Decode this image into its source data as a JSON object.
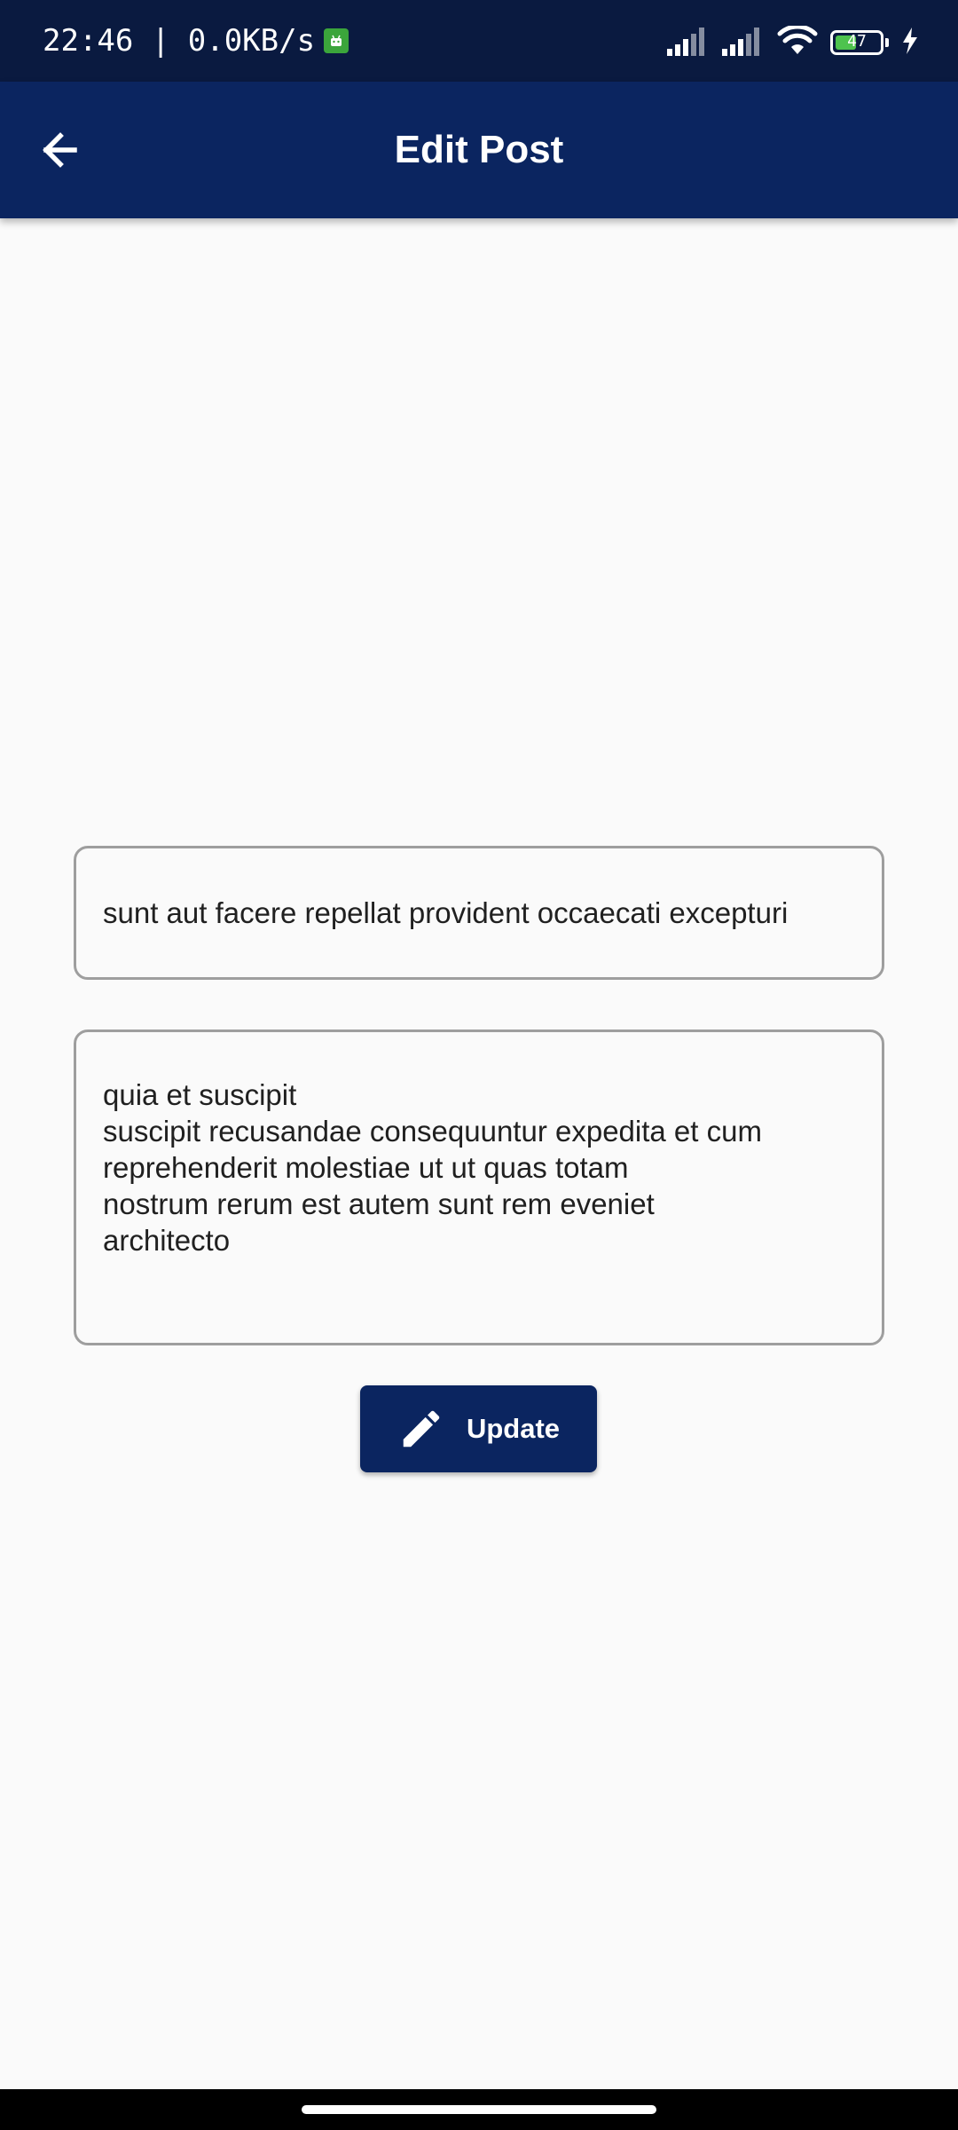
{
  "status_bar": {
    "time_speed": "22:46 | 0.0KB/s",
    "battery_level": "47",
    "battery_fraction": 0.47,
    "icons": [
      "signal-icon",
      "signal-icon",
      "wifi-icon",
      "battery-icon",
      "charging-icon"
    ]
  },
  "app_bar": {
    "title": "Edit Post",
    "back_icon": "arrow-left-icon"
  },
  "form": {
    "title_value": "sunt aut facere repellat provident occaecati excepturi",
    "body_lines": [
      "quia et suscipit",
      "suscipit recusandae consequuntur expedita et cum",
      "reprehenderit molestiae ut ut quas totam",
      "nostrum rerum est autem sunt rem eveniet",
      "architecto"
    ],
    "update_label": "Update",
    "update_icon": "pencil-icon"
  },
  "colors": {
    "status_bar": "#0a1a40",
    "app_bar": "#0b2560",
    "button": "#0b2560",
    "background": "#fafafa",
    "field_border": "#9e9e9e",
    "battery_fill": "#4ec34e"
  }
}
